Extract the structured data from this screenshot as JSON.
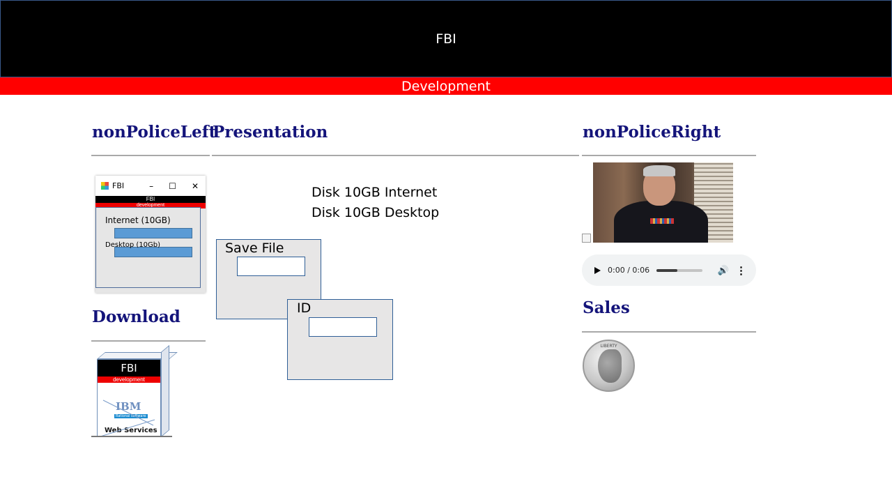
{
  "header": {
    "title": "FBI",
    "subtitle": "Development"
  },
  "left": {
    "heading": "nonPoliceLeft",
    "mini_app": {
      "window_title": "FBI",
      "banner_title": "FBI",
      "banner_subtitle": "development",
      "internet_label": "Internet (10GB)",
      "desktop_label": "Desktop (10Gb)"
    },
    "download_heading": "Download",
    "download_box": {
      "brand": "FBI",
      "tagline": "development",
      "logo_text": "IBM",
      "logo_sub": "Rational software",
      "product": "Web Services"
    }
  },
  "center": {
    "heading": "Presentation",
    "disk_lines": [
      "Disk 10GB Internet",
      "Disk 10GB Desktop"
    ],
    "save_panel": {
      "label": "Save File",
      "value": ""
    },
    "id_panel": {
      "label": "ID",
      "value": ""
    }
  },
  "right": {
    "heading": "nonPoliceRight",
    "audio": {
      "time": "0:00 / 0:06",
      "progress": 0.45
    },
    "sales_heading": "Sales",
    "coin_text": "LIBERTY"
  },
  "colors": {
    "header_bg": "#000000",
    "subbar_bg": "#ff0000",
    "heading": "#14147a",
    "panel_bg": "#e7e6e6",
    "accent_bar": "#5b9bd5"
  },
  "icons": [
    "app-icon",
    "minimize-icon",
    "maximize-icon",
    "close-icon",
    "play-icon",
    "volume-icon",
    "more-icon",
    "broken-image-icon"
  ]
}
